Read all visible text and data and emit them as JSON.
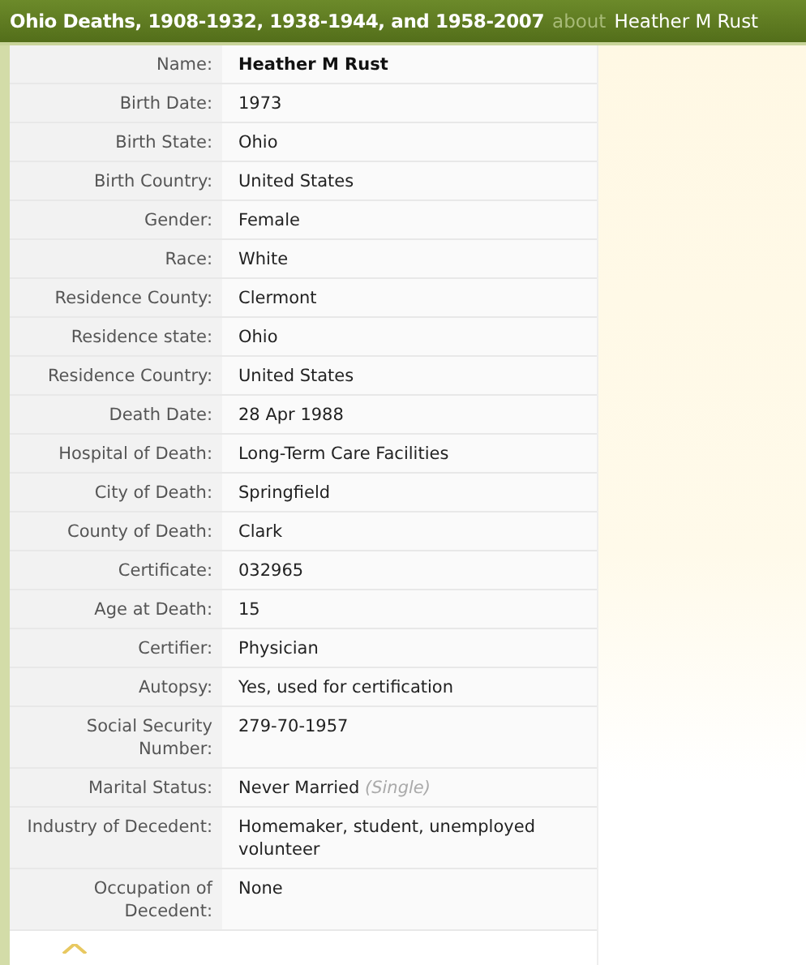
{
  "header": {
    "title": "Ohio Deaths, 1908-1932, 1938-1944, and 1958-2007",
    "connector": "about",
    "person": "Heather M Rust"
  },
  "fields": [
    {
      "label": "Name:",
      "value": "Heather M Rust",
      "kind": "name"
    },
    {
      "label": "Birth Date:",
      "value": "1973"
    },
    {
      "label": "Birth State:",
      "value": "Ohio"
    },
    {
      "label": "Birth Country:",
      "value": "United States"
    },
    {
      "label": "Gender:",
      "value": "Female"
    },
    {
      "label": "Race:",
      "value": "White"
    },
    {
      "label": "Residence County:",
      "value": "Clermont"
    },
    {
      "label": "Residence state:",
      "value": "Ohio"
    },
    {
      "label": "Residence Country:",
      "value": "United States"
    },
    {
      "label": "Death Date:",
      "value": "28 Apr 1988"
    },
    {
      "label": "Hospital of Death:",
      "value": "Long-Term Care Facilities"
    },
    {
      "label": "City of Death:",
      "value": "Springfield"
    },
    {
      "label": "County of Death:",
      "value": "Clark"
    },
    {
      "label": "Certificate:",
      "value": "032965"
    },
    {
      "label": "Age at Death:",
      "value": "15"
    },
    {
      "label": "Certifier:",
      "value": "Physician"
    },
    {
      "label": "Autopsy:",
      "value": "Yes, used for certification"
    },
    {
      "label": "Social Security Number:",
      "value": "279-70-1957"
    },
    {
      "label": "Marital Status:",
      "value": "Never Married",
      "note": "(Single)"
    },
    {
      "label": "Industry of Decedent:",
      "value": "Homemaker, student, unemployed volunteer"
    },
    {
      "label": "Occupation of Decedent:",
      "value": "None"
    }
  ]
}
